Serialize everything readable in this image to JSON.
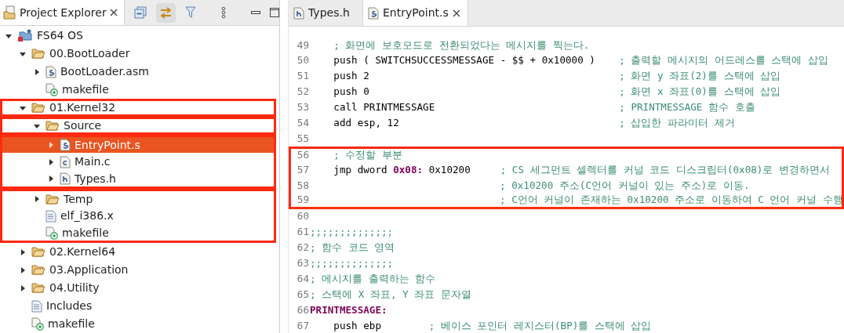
{
  "explorer": {
    "title": "Project Explorer",
    "tree": [
      {
        "label": "FS64 OS",
        "kind": "project",
        "expanded": true,
        "selected": false,
        "children": [
          {
            "label": "00.BootLoader",
            "kind": "folder",
            "expanded": true,
            "selected": false,
            "children": [
              {
                "label": "BootLoader.asm",
                "kind": "asm",
                "expanded": false,
                "selected": false
              },
              {
                "label": "makefile",
                "kind": "makefile",
                "selected": false
              }
            ]
          },
          {
            "label": "01.Kernel32",
            "kind": "folder",
            "expanded": true,
            "selected": false,
            "boxed": true,
            "box_start": true,
            "children": [
              {
                "label": "Source",
                "kind": "folder",
                "expanded": true,
                "selected": false,
                "boxed": true,
                "box_start": true,
                "children": [
                  {
                    "label": "EntryPoint.s",
                    "kind": "asm",
                    "expanded": false,
                    "selected": true,
                    "boxed": true,
                    "box_start": true
                  },
                  {
                    "label": "Main.c",
                    "kind": "c",
                    "expanded": false,
                    "selected": false,
                    "boxed": true
                  },
                  {
                    "label": "Types.h",
                    "kind": "h",
                    "expanded": false,
                    "selected": false,
                    "boxed": true
                  }
                ]
              },
              {
                "label": "Temp",
                "kind": "folder",
                "expanded": false,
                "selected": false,
                "boxed": true,
                "box_start": true
              },
              {
                "label": "elf_i386.x",
                "kind": "text",
                "selected": false,
                "boxed": true
              },
              {
                "label": "makefile",
                "kind": "makefile",
                "selected": false,
                "boxed": true
              }
            ]
          },
          {
            "label": "02.Kernel64",
            "kind": "folder",
            "expanded": false,
            "selected": false
          },
          {
            "label": "03.Application",
            "kind": "folder",
            "expanded": false,
            "selected": false
          },
          {
            "label": "04.Utility",
            "kind": "folder",
            "expanded": false,
            "selected": false
          },
          {
            "label": "Includes",
            "kind": "text",
            "selected": false
          },
          {
            "label": "makefile",
            "kind": "makefile",
            "selected": false
          }
        ]
      }
    ]
  },
  "editor": {
    "tabs": [
      {
        "label": "Types.h",
        "kind": "h",
        "selected": false
      },
      {
        "label": "EntryPoint.s",
        "kind": "asm",
        "selected": true
      }
    ],
    "lines": [
      {
        "number": "49",
        "segments": [
          {
            "kind": "comment",
            "text": "    ; 화면에 보호모드로 전환되었다는 메시지를 찍는다."
          }
        ]
      },
      {
        "number": "50",
        "segments": [
          {
            "kind": "code",
            "text": "    push ( SWITCHSUCCESSMESSAGE - $$ + 0x10000 )    "
          },
          {
            "kind": "comment",
            "text": "; 출력할 메시지의 어드레스를 스택에 삽입"
          }
        ]
      },
      {
        "number": "51",
        "segments": [
          {
            "kind": "code",
            "text": "    push 2                                          "
          },
          {
            "kind": "comment",
            "text": "; 화면 y 좌표(2)를 스택에 삽입"
          }
        ]
      },
      {
        "number": "52",
        "segments": [
          {
            "kind": "code",
            "text": "    push 0                                          "
          },
          {
            "kind": "comment",
            "text": "; 화면 x 좌표(0)를 스택에 삽입"
          }
        ]
      },
      {
        "number": "53",
        "segments": [
          {
            "kind": "code",
            "text": "    call PRINTMESSAGE                               "
          },
          {
            "kind": "comment",
            "text": "; PRINTMESSAGE 함수 호출"
          }
        ]
      },
      {
        "number": "54",
        "segments": [
          {
            "kind": "code",
            "text": "    add esp, 12                                     "
          },
          {
            "kind": "comment",
            "text": "; 삽입한 파라미터 제거"
          }
        ]
      },
      {
        "number": "55"
      },
      {
        "number": "56",
        "boxed": true,
        "segments": [
          {
            "kind": "comment",
            "text": "    ; 수정할 부분"
          }
        ]
      },
      {
        "number": "57",
        "boxed": true,
        "segments": [
          {
            "kind": "code",
            "text": "    jmp dword "
          },
          {
            "kind": "keyword",
            "text": "0x08:"
          },
          {
            "kind": "code",
            "text": " 0x10200     "
          },
          {
            "kind": "comment",
            "text": "; CS 세그먼트 셀렉터를 커널 코드 디스크립터(0x08)로 변경하면서"
          }
        ]
      },
      {
        "number": "58",
        "boxed": true,
        "segments": [
          {
            "kind": "aligned_comment",
            "text": "; 0x10200 주소(C언어 커널이 있는 주소)로 이동."
          }
        ]
      },
      {
        "number": "59",
        "boxed": true,
        "segments": [
          {
            "kind": "aligned_comment",
            "text": "; C언어 커널이 존재하는 0x10200 주소로 이동하여 C 언어 커널 수행"
          }
        ]
      },
      {
        "number": "60"
      },
      {
        "number": "61",
        "segments": [
          {
            "kind": "comment",
            "text": ";;;;;;;;;;;;;;"
          }
        ]
      },
      {
        "number": "62",
        "segments": [
          {
            "kind": "comment",
            "text": "; 함수 코드 영역"
          }
        ]
      },
      {
        "number": "63",
        "segments": [
          {
            "kind": "comment",
            "text": ";;;;;;;;;;;;;;"
          }
        ]
      },
      {
        "number": "64",
        "segments": [
          {
            "kind": "comment",
            "text": "; 메시지를 출력하는 함수"
          }
        ]
      },
      {
        "number": "65",
        "segments": [
          {
            "kind": "comment",
            "text": "; 스택에 X 좌표, Y 좌표 문자열"
          }
        ]
      },
      {
        "number": "66",
        "segments": [
          {
            "kind": "keyword",
            "text": "PRINTMESSAGE:"
          }
        ]
      },
      {
        "number": "67",
        "segments": [
          {
            "kind": "code",
            "text": "    push ebp        "
          },
          {
            "kind": "comment",
            "text": "; 베이스 포인터 레지스터(BP)를 스택에 삽입"
          }
        ]
      }
    ]
  }
}
